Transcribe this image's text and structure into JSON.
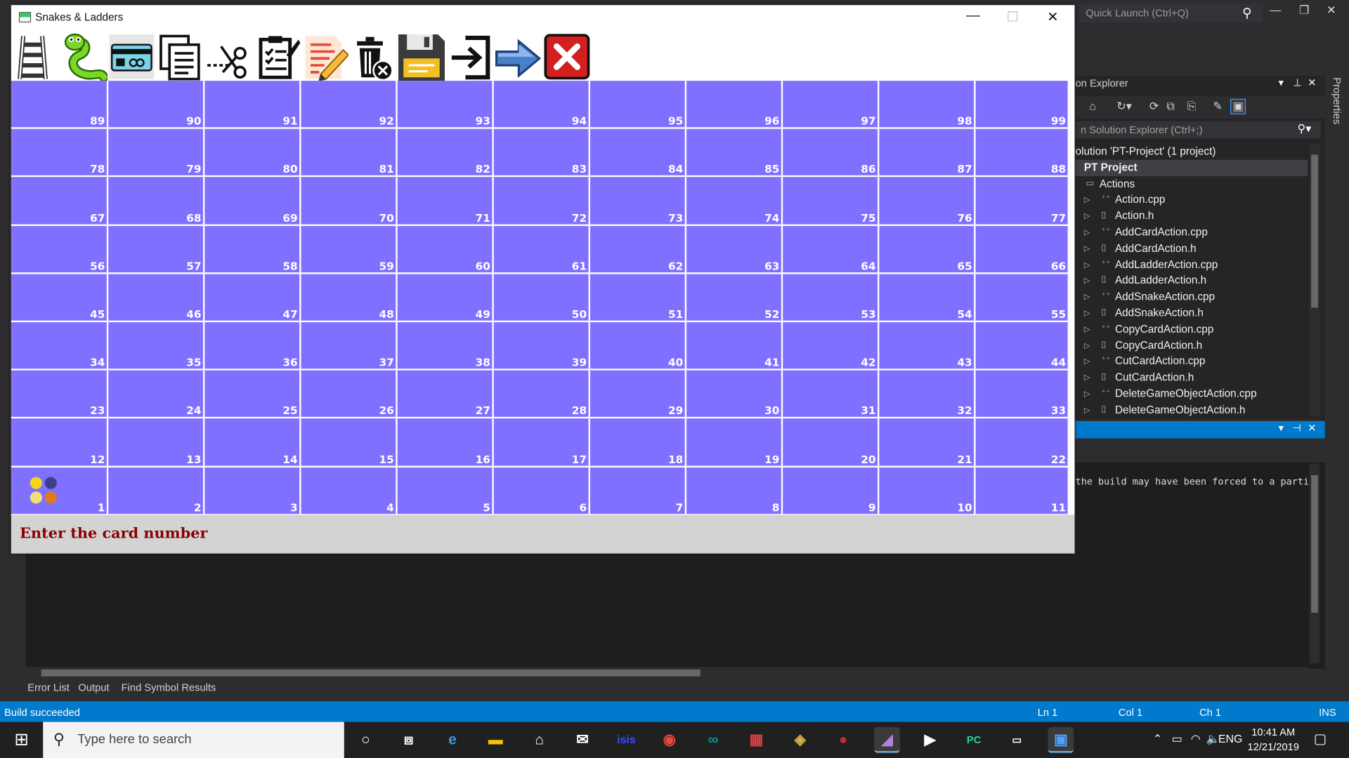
{
  "game_window": {
    "title": "Snakes & Ladders",
    "toolbar_tools": [
      "ladder-icon",
      "snake-icon",
      "card-icon",
      "copy-icon",
      "cut-icon",
      "paste-icon",
      "edit-icon",
      "delete-icon",
      "save-icon",
      "open-icon",
      "switch-mode-icon",
      "exit-icon"
    ],
    "board": {
      "rows": [
        [
          89,
          90,
          91,
          92,
          93,
          94,
          95,
          96,
          97,
          98,
          99
        ],
        [
          78,
          79,
          80,
          81,
          82,
          83,
          84,
          85,
          86,
          87,
          88
        ],
        [
          67,
          68,
          69,
          70,
          71,
          72,
          73,
          74,
          75,
          76,
          77
        ],
        [
          56,
          57,
          58,
          59,
          60,
          61,
          62,
          63,
          64,
          65,
          66
        ],
        [
          45,
          46,
          47,
          48,
          49,
          50,
          51,
          52,
          53,
          54,
          55
        ],
        [
          34,
          35,
          36,
          37,
          38,
          39,
          40,
          41,
          42,
          43,
          44
        ],
        [
          23,
          24,
          25,
          26,
          27,
          28,
          29,
          30,
          31,
          32,
          33
        ],
        [
          12,
          13,
          14,
          15,
          16,
          17,
          18,
          19,
          20,
          21,
          22
        ],
        [
          1,
          2,
          3,
          4,
          5,
          6,
          7,
          8,
          9,
          10,
          11
        ]
      ],
      "cell_color": "#8070ff",
      "player_colors": [
        "#f5d31c",
        "#3d3f8f",
        "#f1e07a",
        "#e07a1f"
      ]
    },
    "status_message": "Enter the card number"
  },
  "vs": {
    "quick_launch_placeholder": "Quick Launch (Ctrl+Q)",
    "solution_explorer_title": "on Explorer",
    "search_placeholder": "n Solution Explorer (Ctrl+;)",
    "tree": [
      {
        "label": "olution 'PT-Project' (1 project)",
        "kind": "solution"
      },
      {
        "label": "PT Project",
        "kind": "project"
      },
      {
        "label": "Actions",
        "kind": "folder"
      },
      {
        "label": "Action.cpp",
        "kind": "cpp"
      },
      {
        "label": "Action.h",
        "kind": "h"
      },
      {
        "label": "AddCardAction.cpp",
        "kind": "cpp"
      },
      {
        "label": "AddCardAction.h",
        "kind": "h"
      },
      {
        "label": "AddLadderAction.cpp",
        "kind": "cpp"
      },
      {
        "label": "AddLadderAction.h",
        "kind": "h"
      },
      {
        "label": "AddSnakeAction.cpp",
        "kind": "cpp"
      },
      {
        "label": "AddSnakeAction.h",
        "kind": "h"
      },
      {
        "label": "CopyCardAction.cpp",
        "kind": "cpp"
      },
      {
        "label": "CopyCardAction.h",
        "kind": "h"
      },
      {
        "label": "CutCardAction.cpp",
        "kind": "cpp"
      },
      {
        "label": "CutCardAction.h",
        "kind": "h"
      },
      {
        "label": "DeleteGameObjectAction.cpp",
        "kind": "cpp"
      },
      {
        "label": "DeleteGameObjectAction.h",
        "kind": "h"
      }
    ],
    "properties_tab": "Properties",
    "output_text": "the build may have been forced to a partic",
    "bottom_tabs": [
      "Error List",
      "Output",
      "Find Symbol Results"
    ],
    "status": {
      "message": "Build succeeded",
      "ln": "Ln 1",
      "col": "Col 1",
      "ch": "Ch 1",
      "mode": "INS"
    }
  },
  "taskbar": {
    "search_placeholder": "Type here to search",
    "language": "ENG",
    "time": "10:41 AM",
    "date": "12/21/2019"
  }
}
